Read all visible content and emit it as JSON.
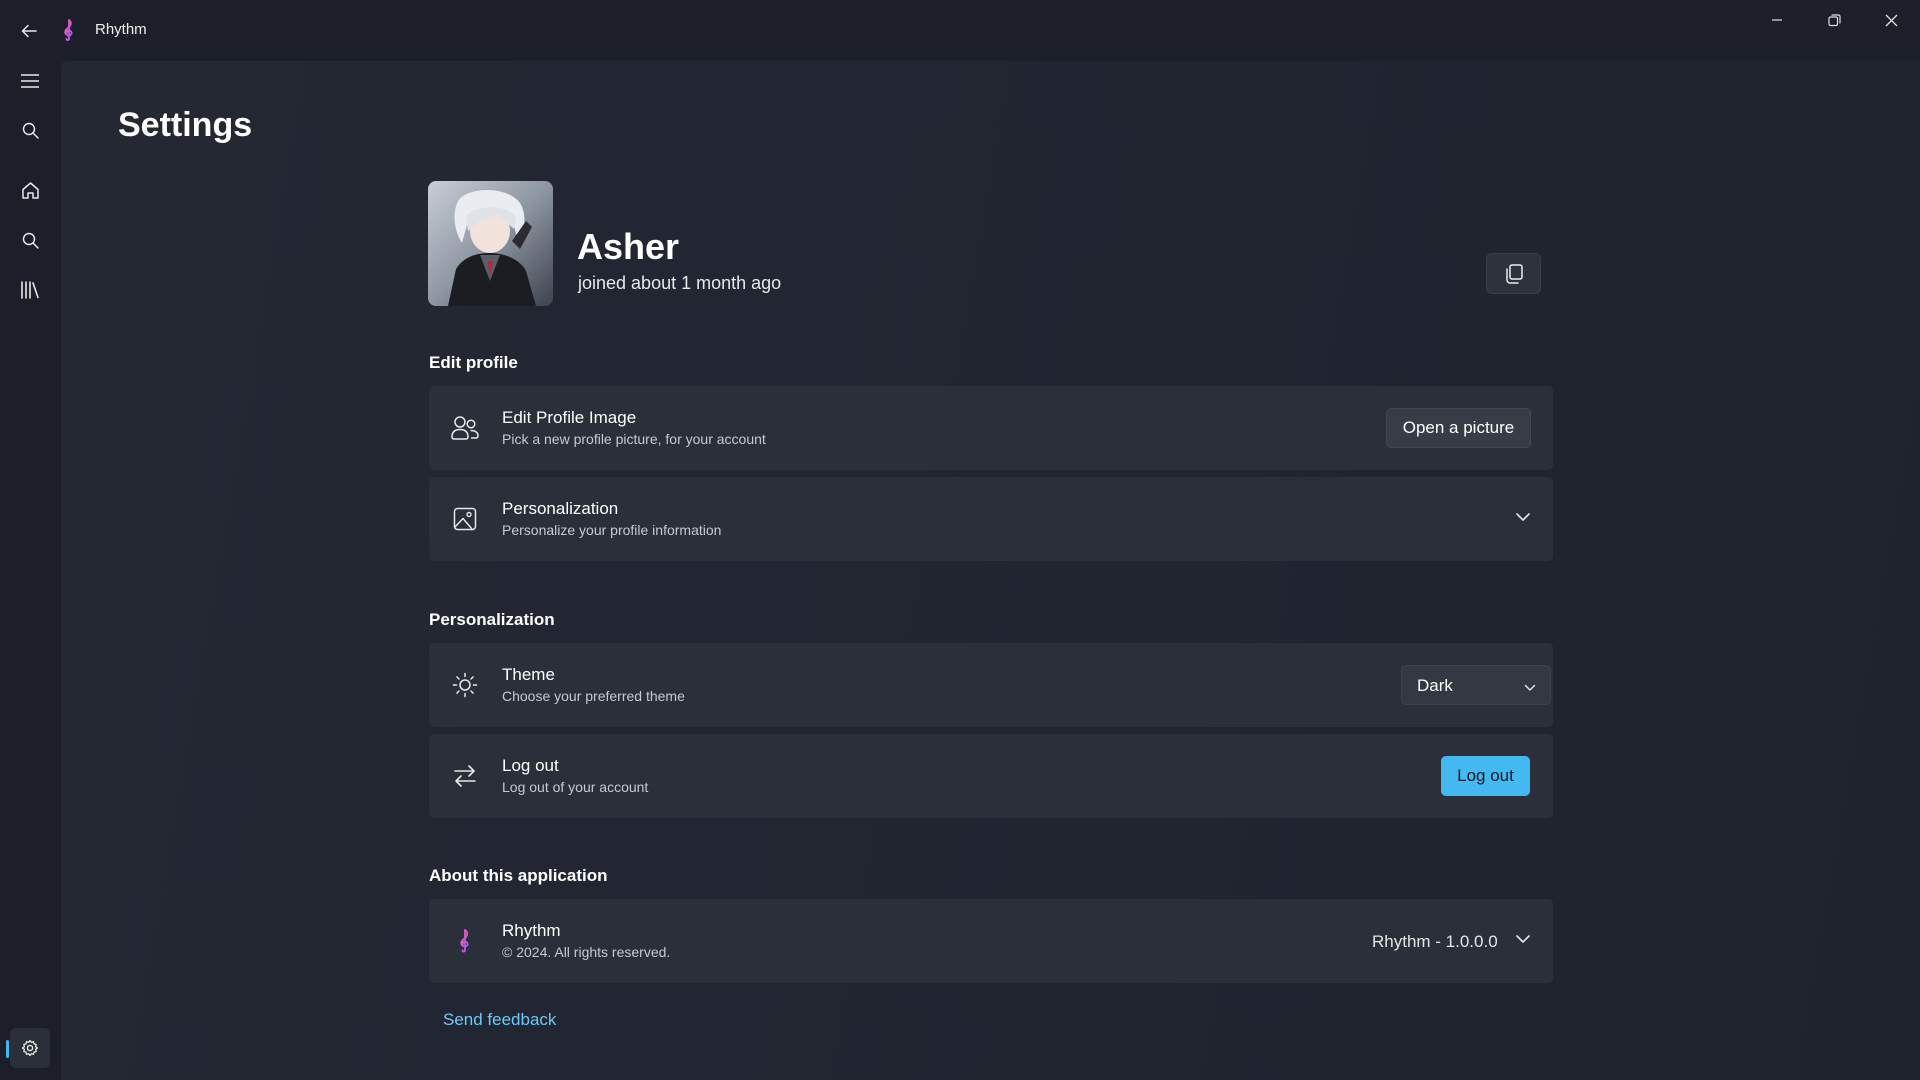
{
  "window": {
    "title": "Rhythm"
  },
  "page": {
    "title": "Settings"
  },
  "profile": {
    "name": "Asher",
    "joined": "joined about 1 month ago"
  },
  "sections": {
    "edit_profile": "Edit profile",
    "personalization": "Personalization",
    "about": "About this application"
  },
  "cards": {
    "edit_image": {
      "title": "Edit Profile Image",
      "description": "Pick a new profile picture, for your account",
      "button": "Open a picture"
    },
    "personalization": {
      "title": "Personalization",
      "description": "Personalize your profile information"
    },
    "theme": {
      "title": "Theme",
      "description": "Choose your preferred theme",
      "selected": "Dark"
    },
    "logout": {
      "title": "Log out",
      "description": "Log out of your account",
      "button": "Log out"
    },
    "about": {
      "title": "Rhythm",
      "description": "© 2024. All rights reserved.",
      "version": "Rhythm - 1.0.0.0"
    }
  },
  "links": {
    "feedback": "Send feedback"
  },
  "colors": {
    "accent": "#43b8f1",
    "link": "#6fc8f5",
    "logo_gradient_start": "#ff5aa8",
    "logo_gradient_end": "#9b5cff"
  },
  "icons": {
    "back": "arrow-left-icon",
    "logo": "treble-clef-icon",
    "menu": "hamburger-icon",
    "search": "search-icon",
    "home": "home-icon",
    "library": "library-icon",
    "settings": "gear-icon",
    "copy": "copy-icon",
    "people": "people-icon",
    "image": "image-icon",
    "theme": "brightness-icon",
    "logout": "arrows-swap-icon",
    "chevron": "chevron-down-icon"
  }
}
